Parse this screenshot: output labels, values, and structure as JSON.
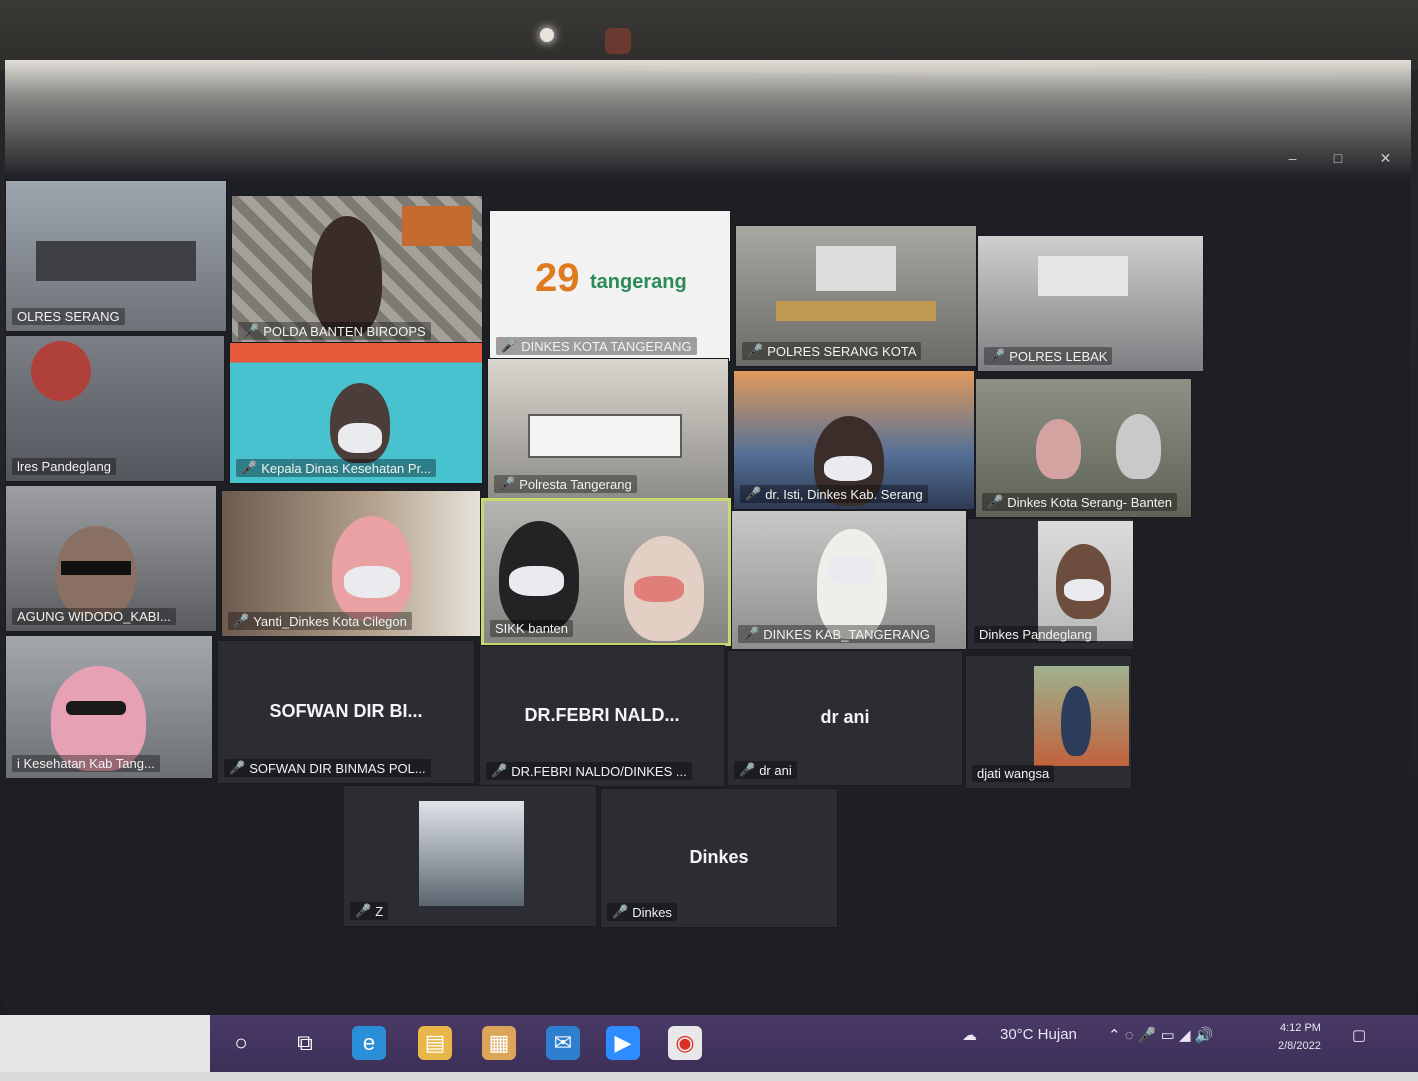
{
  "participants": [
    {
      "label": "OLRES SERANG"
    },
    {
      "label": "POLDA BANTEN BIROOPS"
    },
    {
      "label": "DINKES KOTA TANGERANG",
      "logo_text": "tangerang",
      "logo_number": "29"
    },
    {
      "label": "POLRES SERANG KOTA"
    },
    {
      "label": "POLRES LEBAK"
    },
    {
      "label": "lres Pandeglang"
    },
    {
      "label": "Kepala Dinas Kesehatan Pr..."
    },
    {
      "label": "Polresta Tangerang"
    },
    {
      "label": "dr. Isti, Dinkes Kab. Serang"
    },
    {
      "label": "Dinkes Kota Serang- Banten"
    },
    {
      "label": "AGUNG WIDODO_KABI..."
    },
    {
      "label": "Yanti_Dinkes Kota Cilegon"
    },
    {
      "label": "SIKK banten"
    },
    {
      "label": "DINKES KAB_TANGERANG"
    },
    {
      "label": "Dinkes Pandeglang"
    },
    {
      "label": "i Kesehatan Kab Tang..."
    },
    {
      "label": "SOFWAN DIR BINMAS POL...",
      "name": "SOFWAN DIR BI..."
    },
    {
      "label": "DR.FEBRI NALDO/DINKES ...",
      "name": "DR.FEBRI NALD..."
    },
    {
      "label": "dr ani",
      "name": "dr ani"
    },
    {
      "label": "djati wangsa"
    },
    {
      "label": "Z"
    },
    {
      "label": "Dinkes",
      "name": "Dinkes"
    }
  ],
  "window_controls": {
    "minimize": "–",
    "maximize": "□",
    "close": "✕"
  },
  "taskbar": {
    "weather": "30°C  Hujan",
    "time": "4:12 PM",
    "date": "2/8/2022"
  },
  "colors": {
    "accent": "#c9d86a",
    "mic_muted": "#e5403a",
    "taskbar": "#3b2f58"
  }
}
